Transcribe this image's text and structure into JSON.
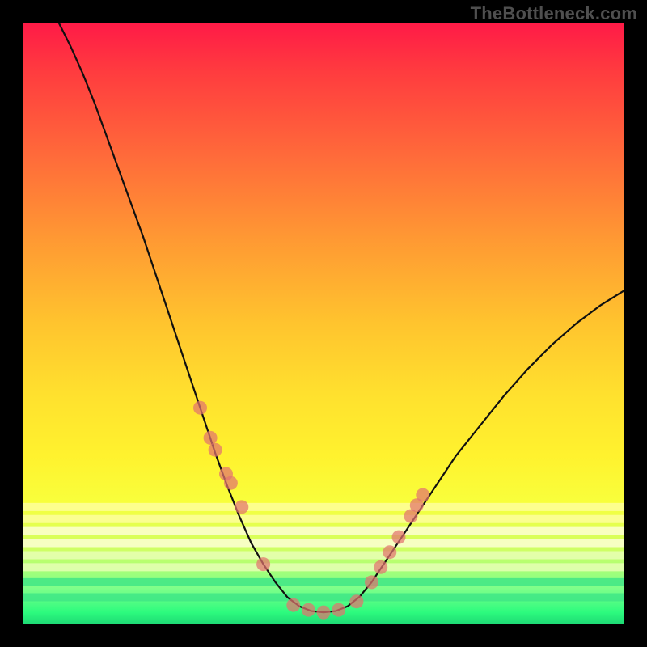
{
  "watermark": "TheBottleneck.com",
  "colors": {
    "marker": "#e2736f",
    "band_outer": "#fffea0",
    "band_mid": "#ffffd9",
    "band_inner": "#eaffb8",
    "band_green": "#3fe686",
    "black": "#000000"
  },
  "chart_data": {
    "type": "line",
    "title": "",
    "xlabel": "",
    "ylabel": "",
    "xlim": [
      0,
      100
    ],
    "ylim": [
      0,
      100
    ],
    "series": [
      {
        "name": "bottleneck-curve",
        "x": [
          6,
          8,
          10,
          12,
          14,
          16,
          18,
          20,
          22,
          24,
          26,
          28,
          30,
          32,
          34,
          36,
          38,
          40,
          42,
          44,
          46,
          48,
          50,
          52,
          54,
          56,
          58,
          60,
          62,
          64,
          66,
          68,
          70,
          72,
          76,
          80,
          84,
          88,
          92,
          96,
          100
        ],
        "y": [
          100,
          96,
          91.5,
          86.5,
          81,
          75.5,
          70,
          64.5,
          58.5,
          52.5,
          46.5,
          40.5,
          34.5,
          28.5,
          23,
          18,
          13.5,
          10,
          7,
          4.5,
          3,
          2.2,
          2,
          2.2,
          3,
          4.6,
          7,
          10,
          13,
          16,
          19,
          22,
          25,
          28,
          33,
          38,
          42.5,
          46.5,
          50,
          53,
          55.5
        ]
      }
    ],
    "markers": {
      "name": "highlighted-points",
      "x": [
        29.5,
        31.2,
        32.0,
        33.8,
        34.6,
        36.4,
        40.0,
        45.0,
        47.5,
        50.0,
        52.5,
        55.5,
        58.0,
        59.5,
        61.0,
        62.5,
        64.5,
        65.5,
        66.5
      ],
      "y": [
        36.0,
        31.0,
        29.0,
        25.0,
        23.5,
        19.5,
        10.0,
        3.2,
        2.4,
        2.0,
        2.4,
        3.8,
        7.0,
        9.5,
        12.0,
        14.5,
        18.0,
        19.8,
        21.5
      ]
    },
    "highlight_bands": [
      {
        "y": 19.5,
        "color_key": "band_outer"
      },
      {
        "y": 17.5,
        "color_key": "band_outer"
      },
      {
        "y": 15.5,
        "color_key": "band_mid"
      },
      {
        "y": 13.5,
        "color_key": "band_mid"
      },
      {
        "y": 11.5,
        "color_key": "band_inner"
      },
      {
        "y": 9.5,
        "color_key": "band_inner"
      },
      {
        "y": 7.0,
        "color_key": "band_green"
      },
      {
        "y": 4.5,
        "color_key": "band_green"
      }
    ]
  }
}
